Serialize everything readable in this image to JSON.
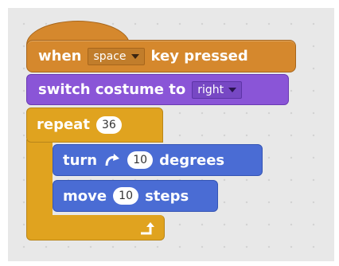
{
  "hat_block": {
    "label_before": "when",
    "key_value": "space",
    "label_after": "key pressed",
    "color": "#d5882d"
  },
  "looks_block": {
    "label": "switch costume to",
    "costume_value": "right",
    "color": "#8a55d7"
  },
  "repeat_block": {
    "label": "repeat",
    "count": "36",
    "color": "#e0a31f",
    "loop_icon": "loop-arrow-icon"
  },
  "turn_block": {
    "label_before": "turn",
    "direction_icon": "rotate-clockwise-icon",
    "degrees": "10",
    "label_after": "degrees",
    "color": "#4a6cd4"
  },
  "move_block": {
    "label_before": "move",
    "steps": "10",
    "label_after": "steps",
    "color": "#4a6cd4"
  }
}
